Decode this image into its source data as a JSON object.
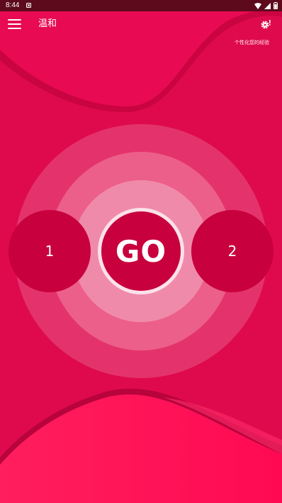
{
  "status_bar": {
    "time": "8:44"
  },
  "app_bar": {
    "title": "温和",
    "menu_icon": "hamburger-menu-icon",
    "settings_icon": "settings-alert-icon"
  },
  "personalize_link": "个性化您的经验",
  "controls": {
    "left_button": "1",
    "go_button": "GO",
    "right_button": "2"
  },
  "colors": {
    "background": "#e2084f",
    "accent_dark": "#c8003d",
    "status_bar": "#5c0a1c"
  }
}
